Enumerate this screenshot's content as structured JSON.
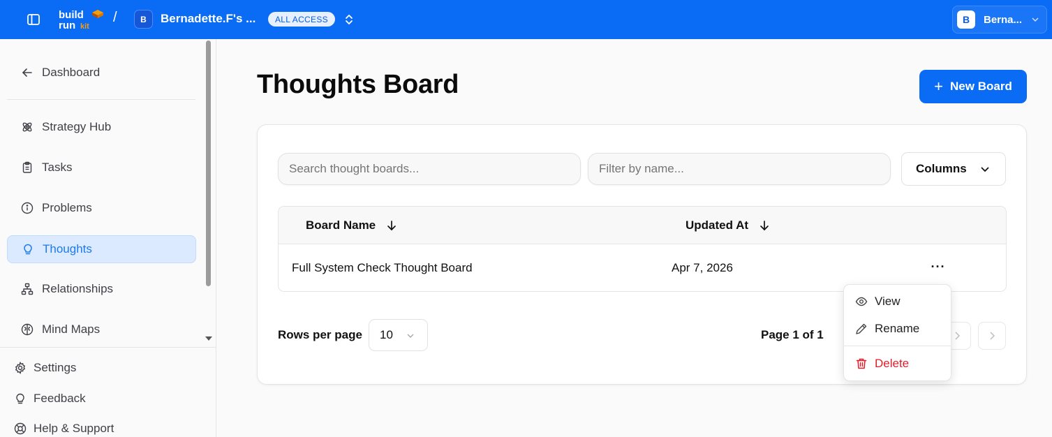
{
  "topbar": {
    "logo_line1": "build",
    "logo_line2": "run",
    "logo_suffix": "kit",
    "separator": "/",
    "workspace_initial": "B",
    "workspace_name": "Bernadette.F's ...",
    "access_badge": "ALL ACCESS",
    "user_initial": "B",
    "user_name": "Berna..."
  },
  "sidebar": {
    "back": "Dashboard",
    "items": [
      {
        "label": "Strategy Hub",
        "icon": "atom-icon"
      },
      {
        "label": "Tasks",
        "icon": "clipboard-icon"
      },
      {
        "label": "Problems",
        "icon": "info-icon"
      },
      {
        "label": "Thoughts",
        "icon": "lightbulb-icon",
        "active": true
      },
      {
        "label": "Relationships",
        "icon": "network-icon"
      },
      {
        "label": "Mind Maps",
        "icon": "brain-icon"
      }
    ],
    "bottom": [
      {
        "label": "Settings",
        "icon": "gear-icon"
      },
      {
        "label": "Feedback",
        "icon": "lightbulb-icon"
      },
      {
        "label": "Help & Support",
        "icon": "lifebuoy-icon"
      }
    ]
  },
  "main": {
    "title": "Thoughts Board",
    "new_button": "New Board",
    "new_button_icon": "+",
    "search_placeholder": "Search thought boards...",
    "filter_placeholder": "Filter by name...",
    "columns_button": "Columns",
    "table": {
      "columns": [
        "Board Name",
        "Updated At"
      ],
      "rows": [
        {
          "name": "Full System Check Thought Board",
          "updated": "Apr 7, 2026",
          "menu": "···"
        }
      ]
    },
    "pagination": {
      "rows_per_page_label": "Rows per page",
      "rows_per_page_value": "10",
      "page_info": "Page 1 of 1"
    }
  },
  "row_menu": {
    "items": [
      {
        "label": "View",
        "icon": "eye-icon"
      },
      {
        "label": "Rename",
        "icon": "pencil-icon"
      },
      {
        "label": "Delete",
        "icon": "trash-icon"
      }
    ]
  },
  "colors": {
    "brand": "#0a6cf5",
    "active_bg": "#dbeafe",
    "danger": "#e11d2a"
  }
}
